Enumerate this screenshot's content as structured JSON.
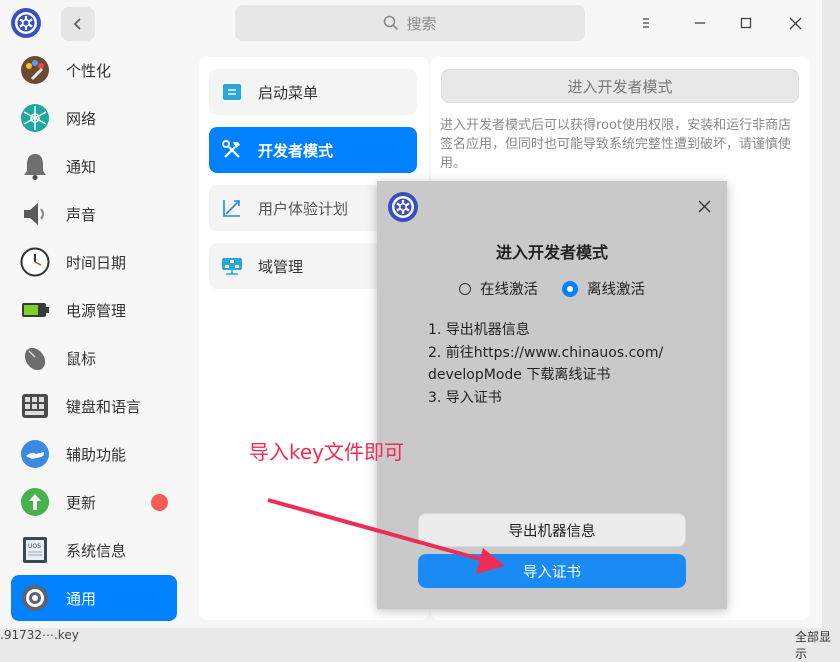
{
  "titlebar": {
    "search_placeholder": "搜索",
    "back_icon": "chevron-left-icon",
    "menu_icon": "menu-icon",
    "minimize_icon": "minimize-icon",
    "maximize_icon": "maximize-icon",
    "close_icon": "close-icon"
  },
  "sidebar": {
    "items": [
      {
        "label": "个性化",
        "icon": "palette-icon"
      },
      {
        "label": "网络",
        "icon": "network-icon"
      },
      {
        "label": "通知",
        "icon": "bell-icon"
      },
      {
        "label": "声音",
        "icon": "speaker-icon"
      },
      {
        "label": "时间日期",
        "icon": "clock-icon"
      },
      {
        "label": "电源管理",
        "icon": "battery-icon"
      },
      {
        "label": "鼠标",
        "icon": "mouse-icon"
      },
      {
        "label": "键盘和语言",
        "icon": "keyboard-icon"
      },
      {
        "label": "辅助功能",
        "icon": "accessibility-icon"
      },
      {
        "label": "更新",
        "icon": "update-icon",
        "badge": true
      },
      {
        "label": "系统信息",
        "icon": "system-info-icon"
      },
      {
        "label": "通用",
        "icon": "gear-icon",
        "active": true
      }
    ]
  },
  "middle": {
    "items": [
      {
        "label": "启动菜单",
        "icon": "boot-menu-icon"
      },
      {
        "label": "开发者模式",
        "icon": "developer-tools-icon",
        "active": true
      },
      {
        "label": "用户体验计划",
        "icon": "chart-line-icon"
      },
      {
        "label": "域管理",
        "icon": "domain-icon"
      }
    ]
  },
  "right": {
    "enter_button": "进入开发者模式",
    "description": "进入开发者模式后可以获得root使用权限，安装和运行非商店签名应用，但同时也可能导致系统完整性遭到破坏，请谨慎使用。"
  },
  "dialog": {
    "title": "进入开发者模式",
    "radio_online": "在线激活",
    "radio_offline": "离线激活",
    "selected": "离线激活",
    "step1": "1. 导出机器信息",
    "step2a": "2. 前往https://www.chinauos.com/",
    "step2b": "developMode 下载离线证书",
    "step3": "3. 导入证书",
    "export_button": "导出机器信息",
    "import_button": "导入证书"
  },
  "annotation": {
    "text": "导入key文件即可",
    "color": "#ef2d53"
  },
  "bottom": {
    "left_text": ".91732⋯.key",
    "right_text": "全部显示"
  },
  "colors": {
    "accent": "#0081ff",
    "badge": "#ff5a5a"
  }
}
